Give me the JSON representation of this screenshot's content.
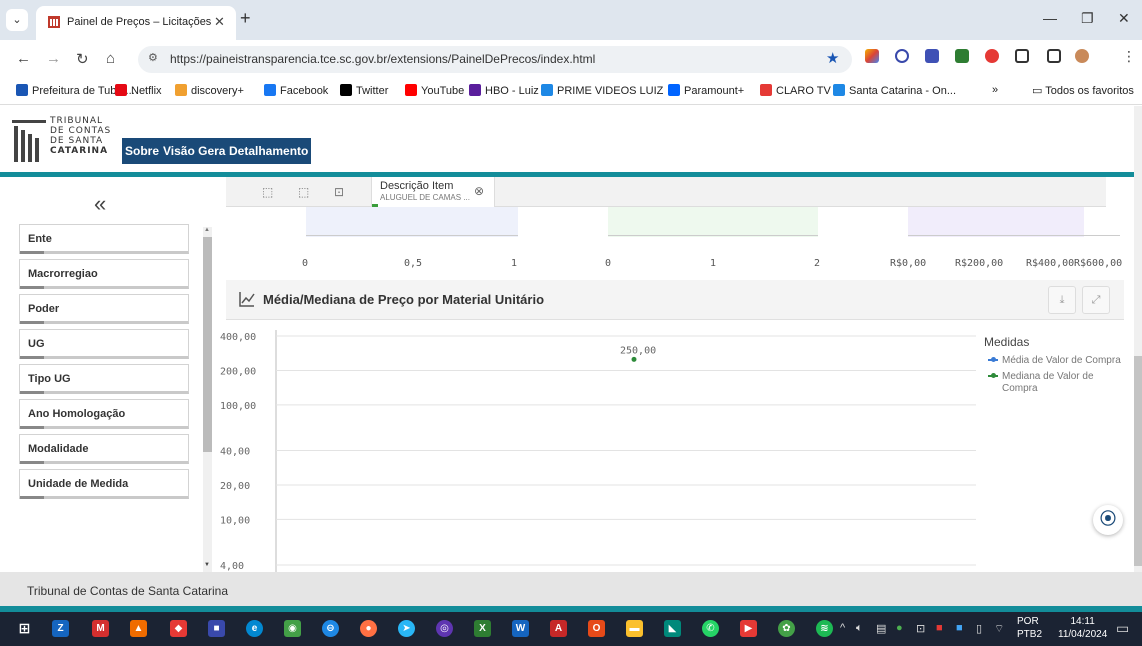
{
  "browser": {
    "tab_title": "Painel de Preços – Licitações",
    "url": "https://paineistransparencia.tce.sc.gov.br/extensions/PainelDePrecos/index.html",
    "bookmarks": [
      {
        "label": "Prefeitura de Tubar...",
        "color": "#1a56b4"
      },
      {
        "label": "Netflix",
        "color": "#e50914"
      },
      {
        "label": "discovery+",
        "color": "#f0a030"
      },
      {
        "label": "Facebook",
        "color": "#1877f2"
      },
      {
        "label": "Twitter",
        "color": "#000000"
      },
      {
        "label": "YouTube",
        "color": "#ff0000"
      },
      {
        "label": "HBO - Luiz",
        "color": "#5a1e9c"
      },
      {
        "label": "PRIME VIDEOS LUIZ",
        "color": "#1e88e5"
      },
      {
        "label": "Paramount+",
        "color": "#0064ff"
      },
      {
        "label": "CLARO TV",
        "color": "#e53935"
      },
      {
        "label": "Santa Catarina - On...",
        "color": "#1e88e5"
      }
    ],
    "bookmarks_more": "»",
    "all_bookmarks": "Todos os favoritos"
  },
  "app": {
    "logo_lines": [
      "TRIBUNAL",
      "DE CONTAS",
      "DE SANTA",
      "CATARINA"
    ],
    "nav_tabs": [
      "Sobre",
      "Visão Geral",
      "Detalhamento"
    ],
    "collapse_icon": "«"
  },
  "filters": [
    "Ente",
    "Macrorregiao",
    "Poder",
    "UG",
    "Tipo UG",
    "Ano Homologação",
    "Modalidade",
    "Unidade de Medida"
  ],
  "selection": {
    "title": "Descrição Item",
    "value": "ALUGUEL DE CAMAS ..."
  },
  "mini_charts": {
    "chart1_ticks": [
      "0",
      "0,5",
      "1"
    ],
    "chart2_ticks": [
      "0",
      "1",
      "2"
    ],
    "chart3_ticks": [
      "R$0,00",
      "R$200,00",
      "R$400,00",
      "R$600,00"
    ]
  },
  "chart": {
    "title": "Média/Mediana de Preço por Material Unitário",
    "legend_title": "Medidas",
    "colors": {
      "media": "#3a7bd5",
      "mediana": "#2e8b3a"
    }
  },
  "chart_data": {
    "type": "scatter",
    "title": "Média/Mediana de Preço por Material Unitário",
    "yscale": "log",
    "yticks": [
      "400,00",
      "200,00",
      "100,00",
      "40,00",
      "20,00",
      "10,00",
      "4,00"
    ],
    "ytick_values": [
      400,
      200,
      100,
      40,
      20,
      10,
      4
    ],
    "series": [
      {
        "name": "Média de Valor de Compra",
        "values": []
      },
      {
        "name": "Mediana de Valor de Compra",
        "values": [
          250
        ]
      }
    ],
    "data_labels": [
      "250,00"
    ],
    "legend": "right"
  },
  "footer": {
    "text": "Tribunal de Contas de Santa Catarina"
  },
  "taskbar": {
    "lang_top": "POR",
    "lang_bottom": "PTB2",
    "time": "14:11",
    "date": "11/04/2024"
  }
}
